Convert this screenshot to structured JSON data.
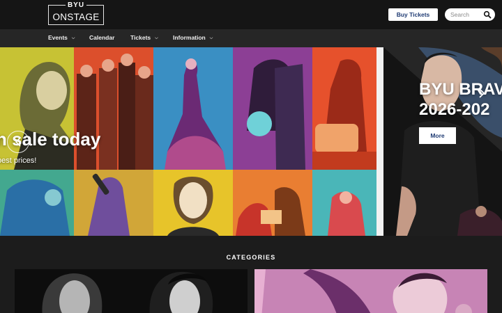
{
  "header": {
    "logo_top": "BYU",
    "logo_bottom": "ONSTAGE",
    "buy_tickets": "Buy Tickets",
    "search_placeholder": "Search"
  },
  "nav": [
    {
      "label": "Events",
      "has_dropdown": true
    },
    {
      "label": "Calendar",
      "has_dropdown": false
    },
    {
      "label": "Tickets",
      "has_dropdown": true
    },
    {
      "label": "Information",
      "has_dropdown": true
    }
  ],
  "hero": {
    "title": "n sale today",
    "subtitle": "best prices!",
    "right_title_line1": "BYU BRAV",
    "right_title_line2": "2026-202",
    "more_label": "More"
  },
  "categories": {
    "heading": "CATEGORIES"
  },
  "icons": {
    "search": "search-icon",
    "dropdown": "chevron-down-icon",
    "prev": "chevron-left-icon",
    "next": "chevron-right-icon"
  },
  "colors": {
    "header_bg": "#151515",
    "nav_bg": "#262626",
    "button_text": "#1f3b73",
    "page_bg": "#1c1c1c"
  }
}
